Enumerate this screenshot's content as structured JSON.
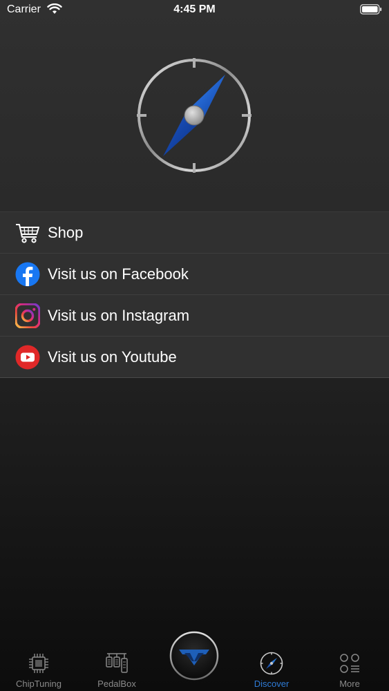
{
  "status_bar": {
    "carrier": "Carrier",
    "time": "4:45 PM"
  },
  "menu": {
    "items": [
      {
        "label": "Shop",
        "icon": "cart-icon"
      },
      {
        "label": "Visit us on Facebook",
        "icon": "facebook-icon"
      },
      {
        "label": "Visit us on Instagram",
        "icon": "instagram-icon"
      },
      {
        "label": "Visit us on Youtube",
        "icon": "youtube-icon"
      }
    ]
  },
  "tab_bar": {
    "tabs": [
      {
        "label": "ChipTuning",
        "icon": "chip-icon",
        "active": false
      },
      {
        "label": "PedalBox",
        "icon": "pedalbox-icon",
        "active": false
      },
      {
        "label": "Discover",
        "icon": "compass-icon",
        "active": true
      },
      {
        "label": "More",
        "icon": "more-icon",
        "active": false
      }
    ],
    "center_button_icon": "brand-logo-icon"
  },
  "colors": {
    "accent": "#2e7bd6",
    "inactive_tab": "#8a8a8a",
    "facebook": "#1877f2",
    "youtube": "#e02828"
  }
}
